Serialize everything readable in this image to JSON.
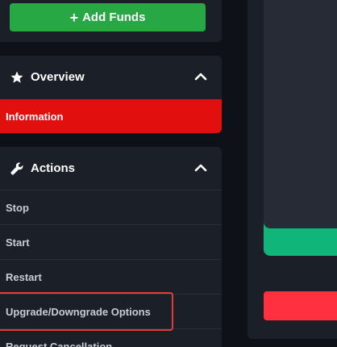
{
  "funds": {
    "add_label": "Add Funds"
  },
  "overview": {
    "title": "Overview",
    "items": [
      {
        "label": "Information"
      }
    ]
  },
  "actions": {
    "title": "Actions",
    "items": [
      {
        "label": "Stop"
      },
      {
        "label": "Start"
      },
      {
        "label": "Restart"
      },
      {
        "label": "Upgrade/Downgrade Options"
      },
      {
        "label": "Request Cancellation"
      }
    ]
  },
  "colors": {
    "background": "#0e1117",
    "panel": "#1b1f27",
    "add_funds": "#28a745",
    "active_item": "#e20f0f",
    "highlight_border": "#e33b3b",
    "green_accent": "#10b57a",
    "red_button": "#ff3040"
  },
  "icons": {
    "add_funds": "plus-icon",
    "overview": "star-icon",
    "actions": "wrench-icon",
    "collapse": "chevron-up-icon"
  }
}
